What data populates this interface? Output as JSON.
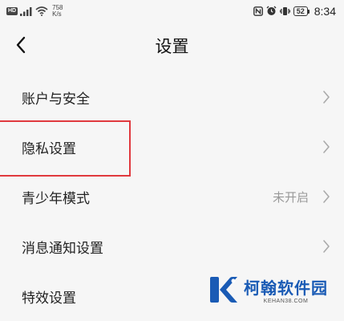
{
  "status_bar": {
    "hd_badge": "HD",
    "net_speed_value": "758",
    "net_speed_unit": "K/s",
    "battery_level": "52",
    "time": "8:34"
  },
  "header": {
    "title": "设置"
  },
  "settings": {
    "items": [
      {
        "label": "账户与安全",
        "value": ""
      },
      {
        "label": "隐私设置",
        "value": ""
      },
      {
        "label": "青少年模式",
        "value": "未开启"
      },
      {
        "label": "消息通知设置",
        "value": ""
      },
      {
        "label": "特效设置",
        "value": ""
      }
    ]
  },
  "watermark": {
    "title": "柯翰软件园",
    "url": "KEHAN38.COM"
  },
  "colors": {
    "background": "#f6f6f6",
    "highlight_border": "#e0393e",
    "watermark_blue": "#1a5bb5",
    "secondary_text": "#999999"
  },
  "icons": {
    "back": "chevron-left-icon",
    "row_arrow": "chevron-right-icon"
  }
}
